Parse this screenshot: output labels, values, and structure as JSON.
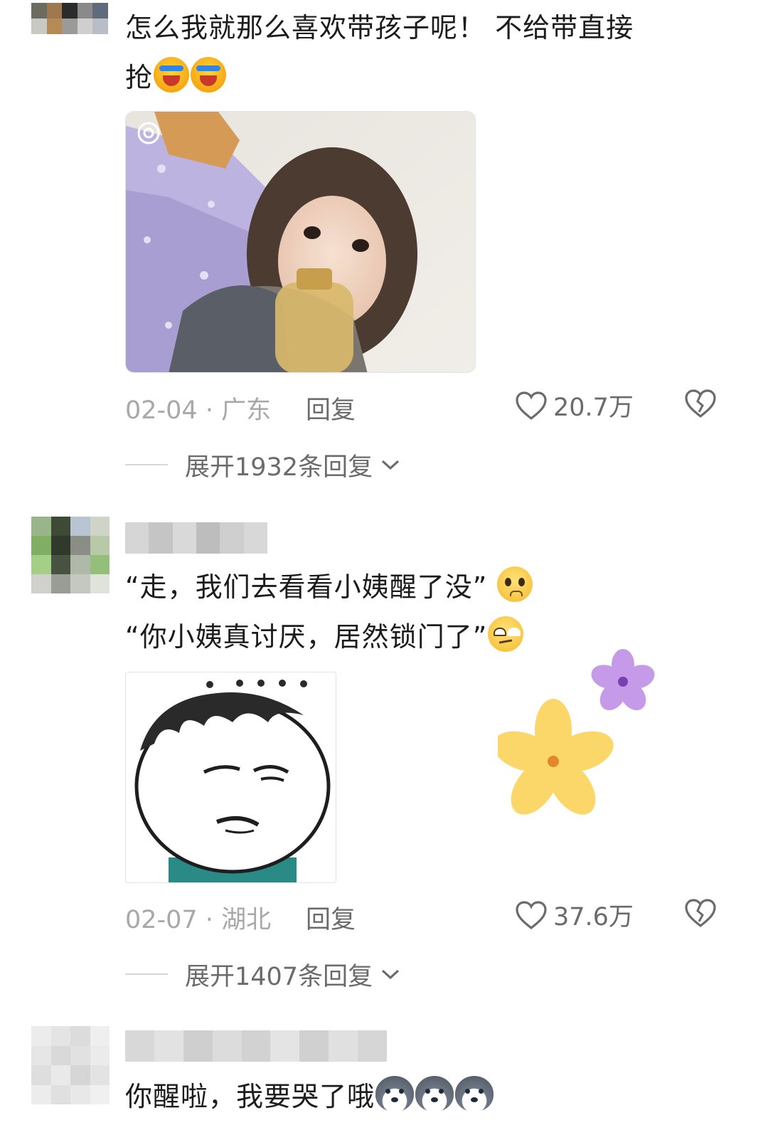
{
  "comments": [
    {
      "text_lines": [
        "怎么我就那么喜欢带孩子呢！ 不给带直接",
        "抢"
      ],
      "date_location": "02-04 · 广东",
      "reply_label": "回复",
      "likes": "20.7万",
      "expand_label": "展开1932条回复"
    },
    {
      "text_lines": [
        "“走，我们去看看小姨醒了没”",
        "“你小姨真讨厌，居然锁门了”"
      ],
      "date_location": "02-07 · 湖北",
      "reply_label": "回复",
      "likes": "37.6万",
      "expand_label": "展开1407条回复"
    },
    {
      "text_lines": [
        "你醒啦，我要哭了哦"
      ]
    }
  ],
  "icons": {
    "like": "heart-outline-icon",
    "dislike": "broken-heart-icon",
    "expand": "chevron-down-icon",
    "emoji_laugh": "laughing-crying-emoji",
    "emoji_plead": "pleading-emoji",
    "emoji_roll": "eye-roll-emoji",
    "emoji_husky": "husky-dog-emoji"
  },
  "colors": {
    "meta_grey": "#a8a8a8",
    "action_grey": "#6b6b6b",
    "text": "#1c1c1c"
  }
}
